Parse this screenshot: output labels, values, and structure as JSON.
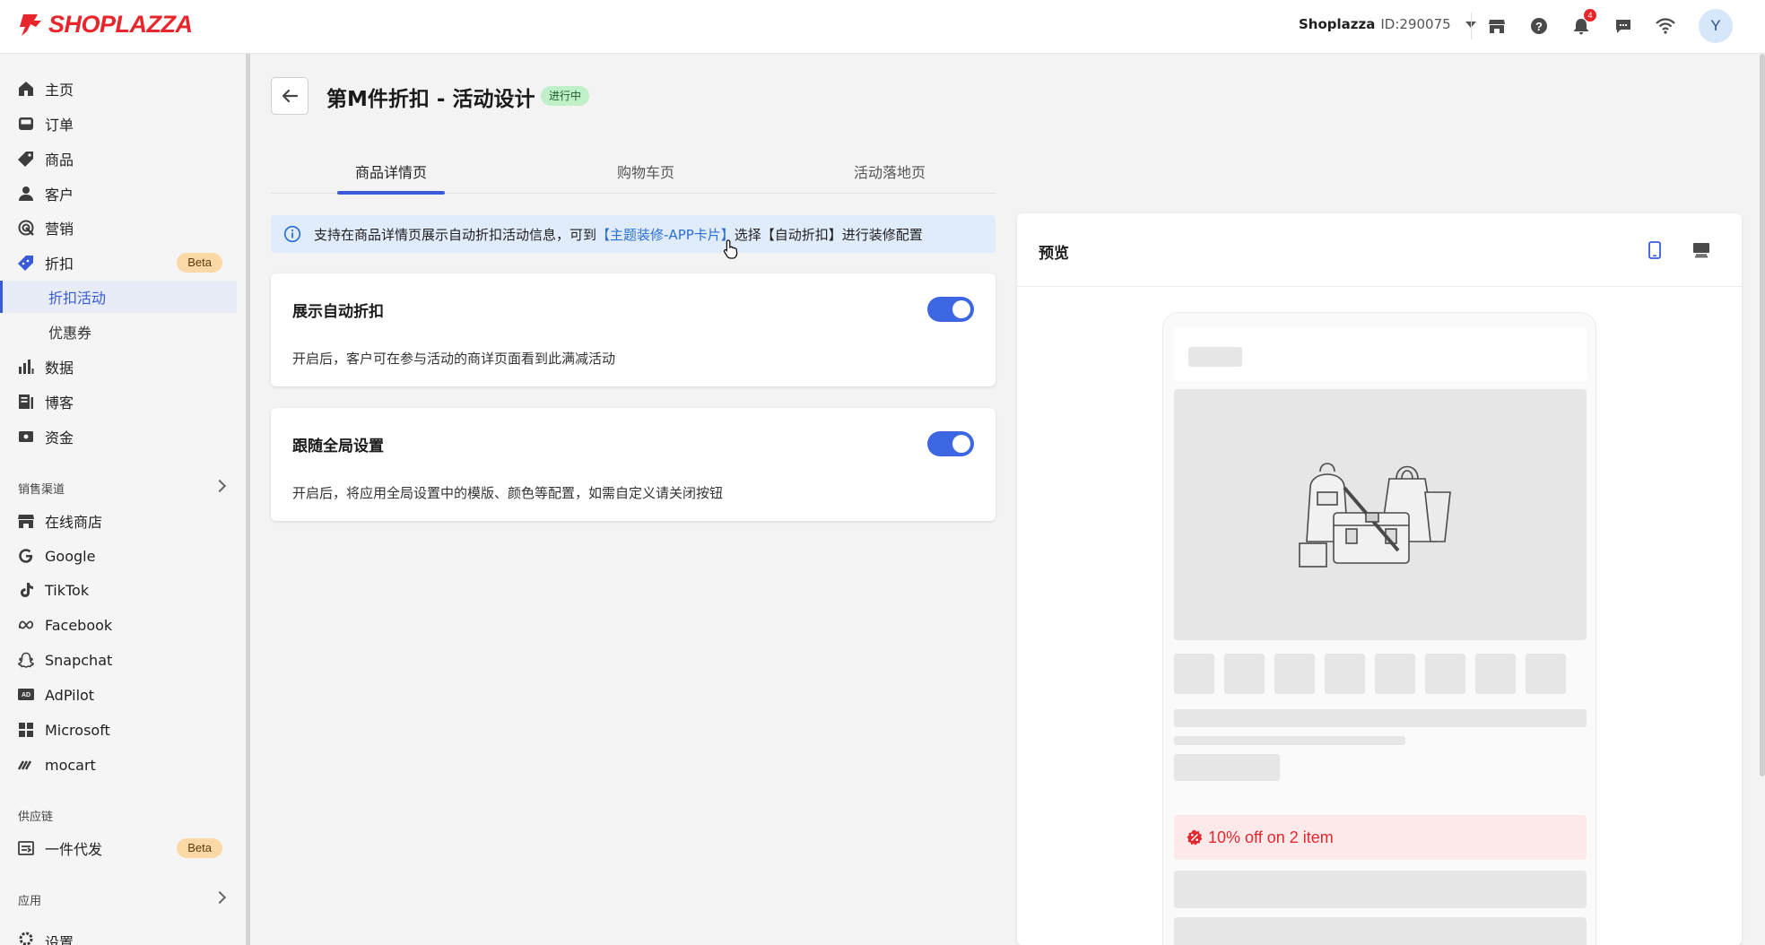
{
  "brand": {
    "logo_text": "SHOPLAZZA",
    "accent": "#3a5bd9",
    "logo_color": "#e8252b"
  },
  "topbar": {
    "store_name": "Shoplazza",
    "store_id": "ID:290075",
    "notification_count": "4",
    "avatar_letter": "Y",
    "icons": [
      "store-icon",
      "help-icon",
      "bell-icon",
      "chat-icon",
      "wifi-icon"
    ]
  },
  "sidebar": {
    "items": [
      {
        "label": "主页",
        "icon": "home-icon"
      },
      {
        "label": "订单",
        "icon": "inbox-icon"
      },
      {
        "label": "商品",
        "icon": "tag-icon"
      },
      {
        "label": "客户",
        "icon": "person-icon"
      },
      {
        "label": "营销",
        "icon": "target-icon"
      },
      {
        "label": "折扣",
        "icon": "discount-icon",
        "badge": "Beta"
      }
    ],
    "sub_items": [
      {
        "label": "折扣活动",
        "active": true
      },
      {
        "label": "优惠券",
        "active": false
      }
    ],
    "items2": [
      {
        "label": "数据",
        "icon": "bar-chart-icon"
      },
      {
        "label": "博客",
        "icon": "blog-icon"
      },
      {
        "label": "资金",
        "icon": "wallet-icon"
      }
    ],
    "sales_channels_label": "销售渠道",
    "channels": [
      {
        "label": "在线商店",
        "icon": "store-icon"
      },
      {
        "label": "Google",
        "icon": "google-icon"
      },
      {
        "label": "TikTok",
        "icon": "tiktok-icon"
      },
      {
        "label": "Facebook",
        "icon": "meta-icon"
      },
      {
        "label": "Snapchat",
        "icon": "snapchat-icon"
      },
      {
        "label": "AdPilot",
        "icon": "ad-icon"
      },
      {
        "label": "Microsoft",
        "icon": "microsoft-icon"
      },
      {
        "label": "mocart",
        "icon": "mocart-icon"
      }
    ],
    "supply_chain_label": "供应链",
    "supply_items": [
      {
        "label": "一件代发",
        "icon": "dropship-icon",
        "badge": "Beta"
      }
    ],
    "apps_label": "应用",
    "settings_label": "设置"
  },
  "main": {
    "title": "第M件折扣 - 活动设计",
    "status": "进行中",
    "tabs": [
      {
        "label": "商品详情页",
        "active": true
      },
      {
        "label": "购物车页",
        "active": false
      },
      {
        "label": "活动落地页",
        "active": false
      }
    ],
    "info": {
      "before": "支持在商品详情页展示自动折扣活动信息，可到",
      "link": "【主题装修-APP卡片】",
      "after": "选择【自动折扣】进行装修配置"
    },
    "cards": [
      {
        "title": "展示自动折扣",
        "desc": "开启后，客户可在参与活动的商详页面看到此满减活动",
        "enabled": true
      },
      {
        "title": "跟随全局设置",
        "desc": "开启后，将应用全局设置中的模版、颜色等配置，如需自定义请关闭按钮",
        "enabled": true
      }
    ]
  },
  "preview": {
    "title": "预览",
    "promo_text": "10% off on 2 item",
    "devices": [
      "mobile-icon",
      "desktop-icon"
    ]
  }
}
